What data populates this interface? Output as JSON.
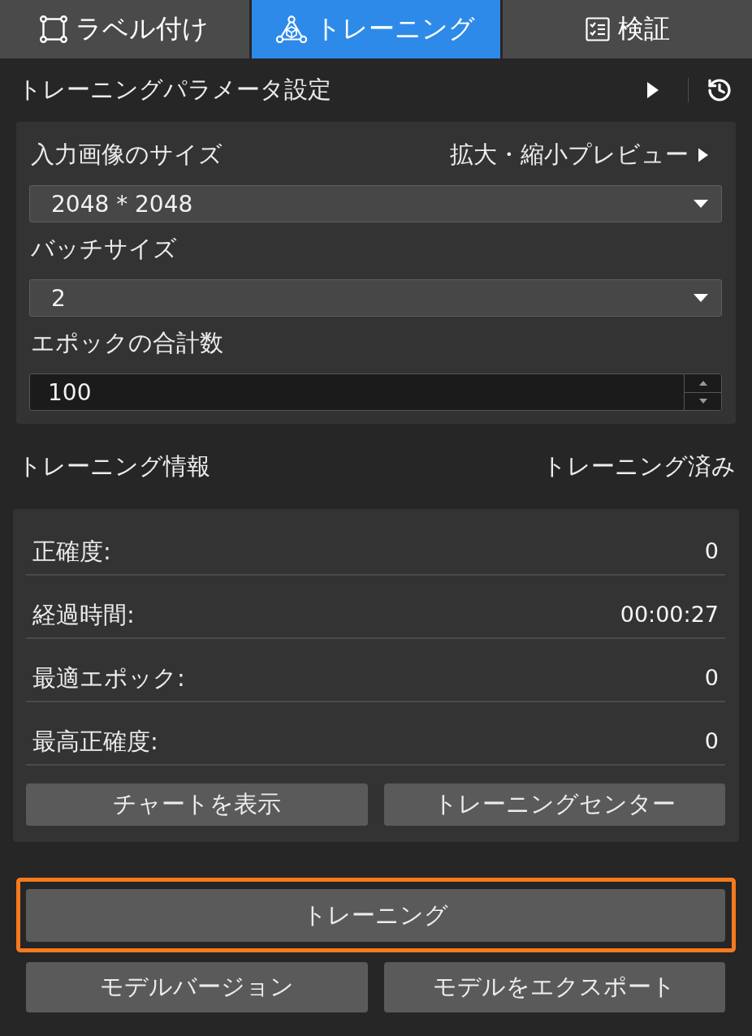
{
  "tabs": [
    {
      "label": "ラベル付け",
      "selected": false
    },
    {
      "label": "トレーニング",
      "selected": true
    },
    {
      "label": "検証",
      "selected": false
    }
  ],
  "parameters": {
    "title": "トレーニングパラメータ設定",
    "fields": [
      {
        "kind": "select",
        "label": "入力画像のサイズ",
        "link": "拡大・縮小プレビュー",
        "value": "2048 * 2048"
      },
      {
        "kind": "select",
        "label": "バッチサイズ",
        "value": "2"
      },
      {
        "kind": "number",
        "label": "エポックの合計数",
        "value": "100"
      }
    ]
  },
  "info": {
    "title": "トレーニング情報",
    "status": "トレーニング済み",
    "rows": [
      {
        "label": "正確度:",
        "value": "0"
      },
      {
        "label": "経過時間:",
        "value": "00:00:27"
      },
      {
        "label": "最適エポック:",
        "value": "0"
      },
      {
        "label": "最高正確度:",
        "value": "0"
      }
    ],
    "buttons": [
      "チャートを表示",
      "トレーニングセンター"
    ]
  },
  "actions": {
    "primary": {
      "label": "トレーニング",
      "highlighted": true
    },
    "buttons": [
      "モデルバージョン",
      "モデルをエクスポート"
    ]
  }
}
